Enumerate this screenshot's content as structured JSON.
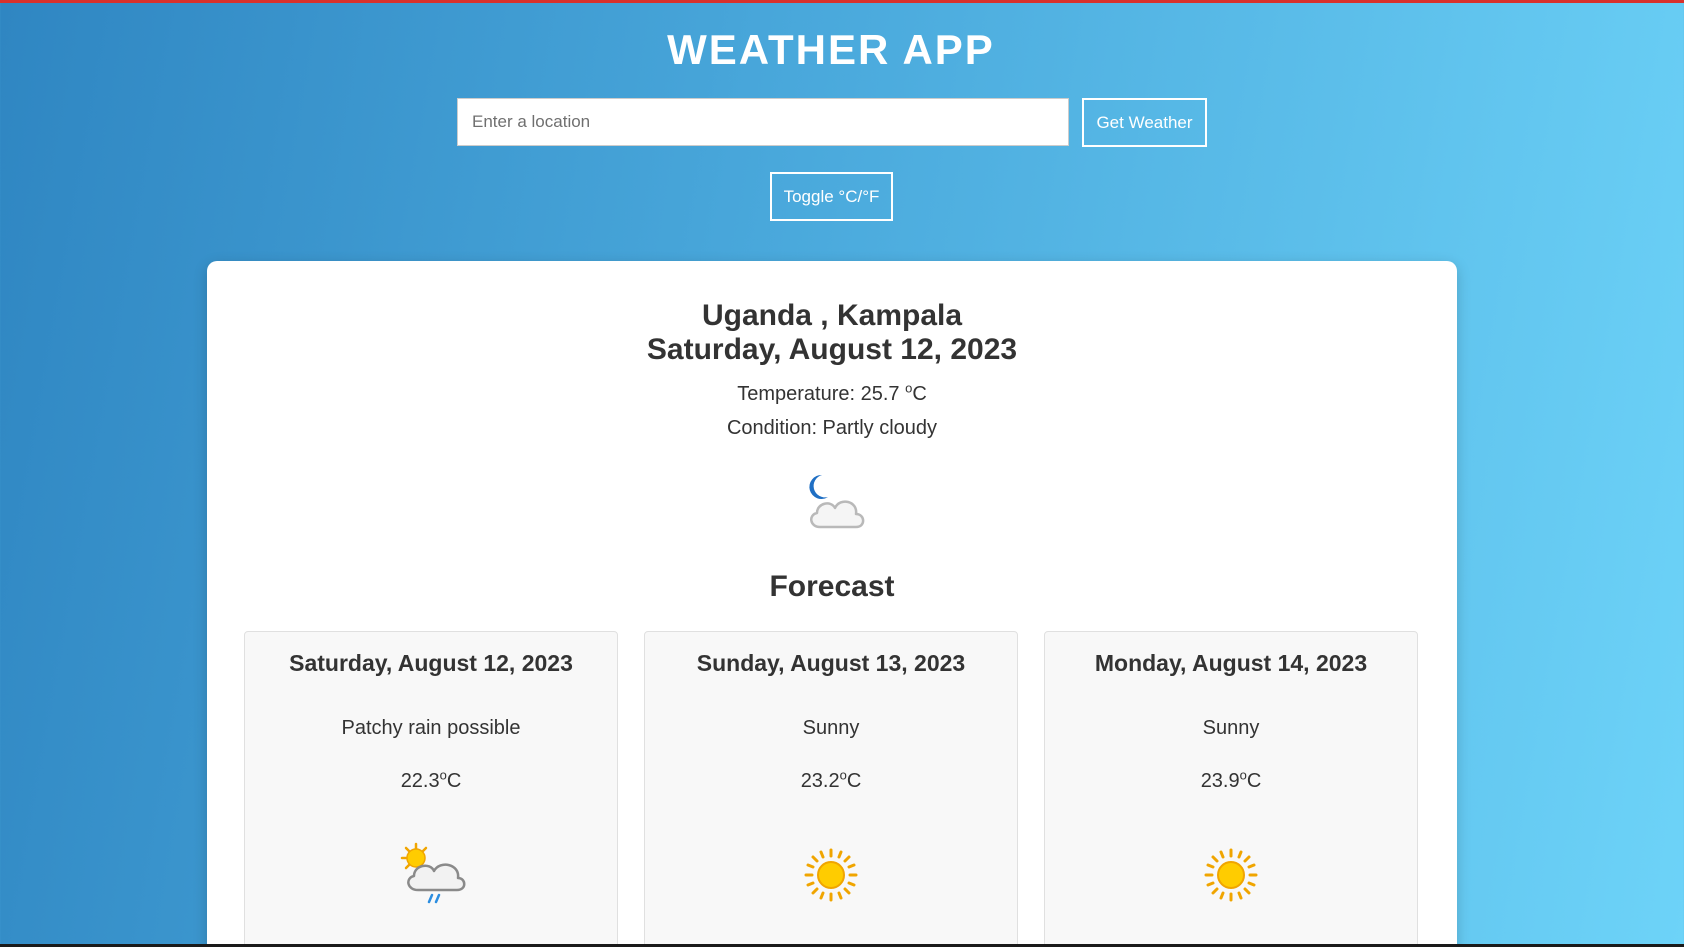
{
  "app": {
    "title": "WEATHER APP"
  },
  "search": {
    "placeholder": "Enter a location",
    "value": ""
  },
  "buttons": {
    "get_weather": "Get Weather",
    "toggle_units": "Toggle °C/°F"
  },
  "current": {
    "location": "Uganda , Kampala",
    "date": "Saturday, August 12, 2023",
    "temperature_label": "Temperature: 25.7 ",
    "temperature_degree": "o",
    "temperature_unit": "C",
    "condition_text": "Condition: Partly cloudy",
    "icon": "moon-partly-cloudy-icon"
  },
  "forecast": {
    "heading": "Forecast",
    "days": [
      {
        "date": "Saturday, August 12, 2023",
        "condition": "Patchy rain possible",
        "temp_value": "22.3",
        "degree": "o",
        "unit": "C",
        "icon": "patchy-rain-icon"
      },
      {
        "date": "Sunday, August 13, 2023",
        "condition": "Sunny",
        "temp_value": "23.2",
        "degree": "o",
        "unit": "C",
        "icon": "sun-icon"
      },
      {
        "date": "Monday, August 14, 2023",
        "condition": "Sunny",
        "temp_value": "23.9",
        "degree": "o",
        "unit": "C",
        "icon": "sun-icon"
      }
    ]
  },
  "colors": {
    "background_start": "#2f86c2",
    "background_end": "#6dd3f8",
    "text_dark": "#333333",
    "sun_yellow": "#ffcc00",
    "moon_blue": "#1f6fc4",
    "rain_blue": "#2b8de0"
  }
}
